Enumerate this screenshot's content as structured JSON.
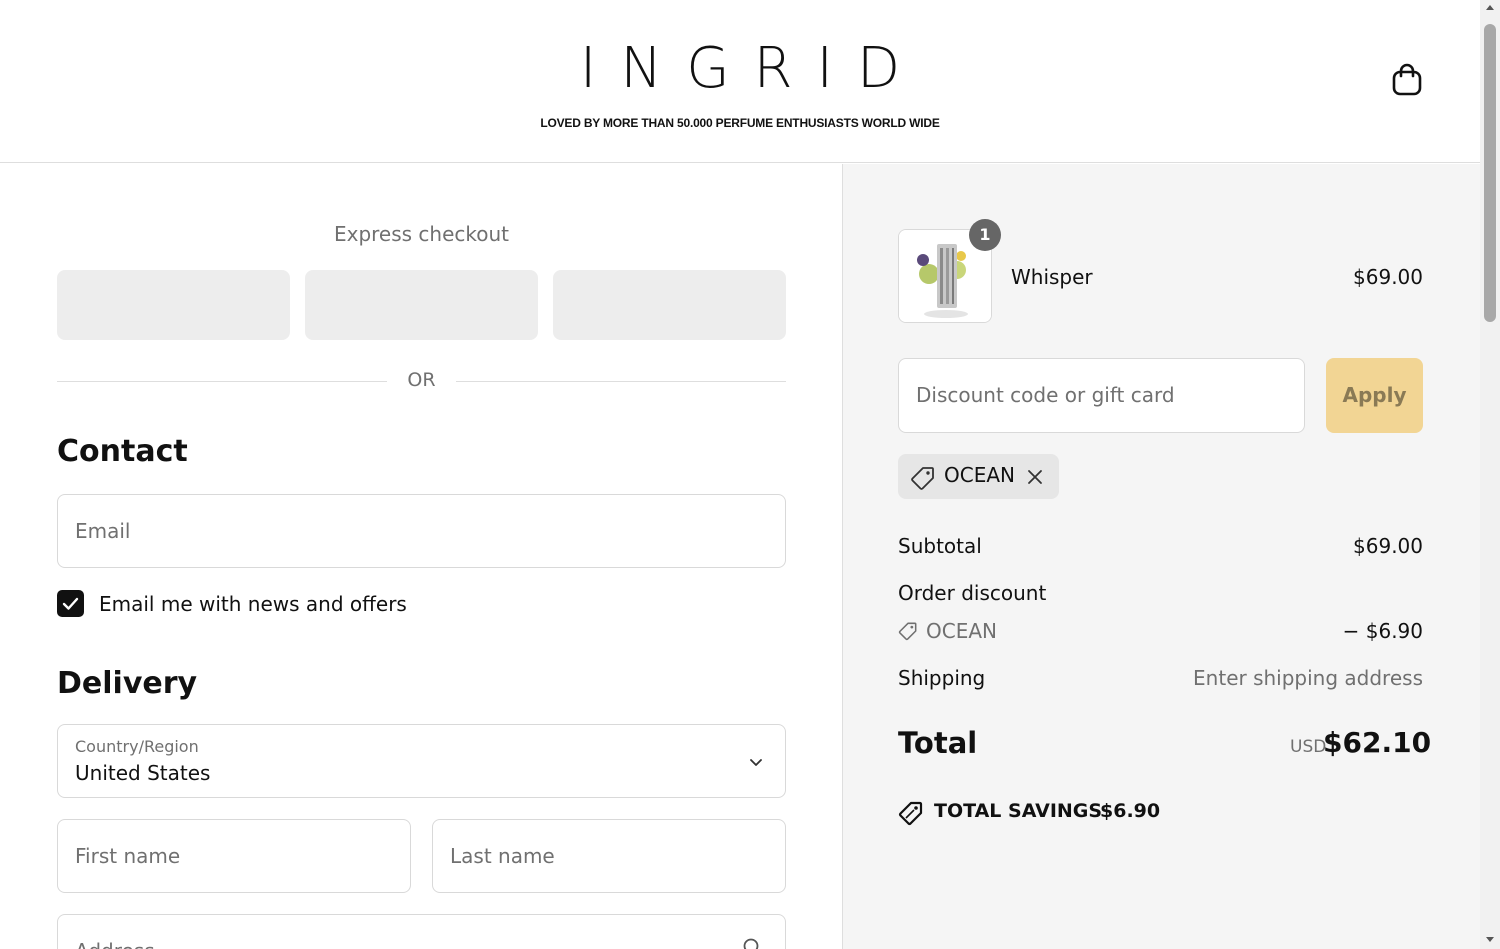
{
  "header": {
    "logo": "INGRID",
    "tagline": "LOVED BY MORE THAN 50.000 PERFUME ENTHUSIASTS WORLD WIDE",
    "cart_icon": "shopping-bag-icon"
  },
  "checkout": {
    "express_title": "Express checkout",
    "or_label": "OR",
    "contact": {
      "title": "Contact",
      "email_placeholder": "Email",
      "newsletter_label": "Email me with news and offers",
      "newsletter_checked": true
    },
    "delivery": {
      "title": "Delivery",
      "country_label": "Country/Region",
      "country_value": "United States",
      "first_name_placeholder": "First name",
      "last_name_placeholder": "Last name",
      "address_placeholder": "Address"
    }
  },
  "summary": {
    "item": {
      "name": "Whisper",
      "price": "$69.00",
      "quantity": "1"
    },
    "discount_placeholder": "Discount code or gift card",
    "apply_label": "Apply",
    "applied_code": "OCEAN",
    "subtotal_label": "Subtotal",
    "subtotal_value": "$69.00",
    "order_discount_label": "Order discount",
    "discount_code": "OCEAN",
    "discount_value": "− $6.90",
    "shipping_label": "Shipping",
    "shipping_value": "Enter shipping address",
    "total_label": "Total",
    "currency": "USD",
    "total_value": "$62.10",
    "savings_label": "TOTAL SAVINGS",
    "savings_value": "$6.90"
  },
  "colors": {
    "apply_button": "#f2d594",
    "summary_background": "#f5f5f5",
    "express_button": "#ededed"
  }
}
